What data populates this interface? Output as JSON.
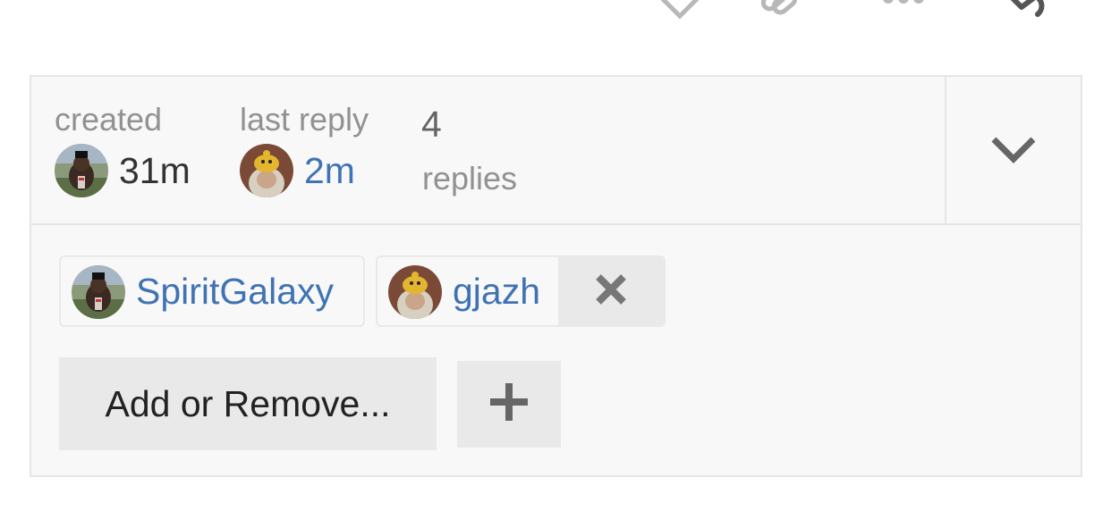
{
  "topic_map": {
    "created_label": "created",
    "created_time": "31m",
    "last_reply_label": "last reply",
    "last_reply_time": "2m",
    "replies_count": "4",
    "replies_label": "replies",
    "expand_icon": "chevron-down-icon"
  },
  "participants": [
    {
      "username": "SpiritGalaxy",
      "avatar": "bear-avatar"
    },
    {
      "username": "gjazh",
      "avatar": "duck-hat-avatar",
      "removable": true
    }
  ],
  "actions": {
    "add_remove_label": "Add or Remove...",
    "add_icon": "plus-icon",
    "remove_icon": "close-icon"
  },
  "colors": {
    "link": "#3f73b3",
    "muted": "#919191",
    "panel_bg": "#f8f8f8",
    "button_bg": "#e9e9e9",
    "border": "#e5e5e5"
  }
}
